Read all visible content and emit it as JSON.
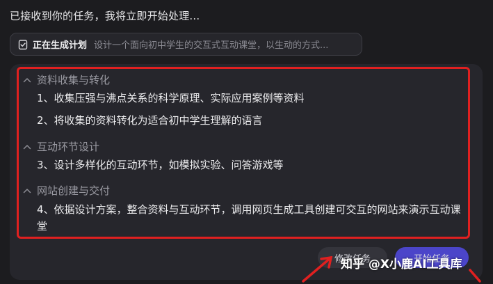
{
  "intro_text": "已接收到你的任务，我将立即开始处理...",
  "status": {
    "label": "正在生成计划",
    "description": "设计一个面向初中学生的交互式互动课堂，以生动的方式..."
  },
  "plan": {
    "sections": [
      {
        "title": "资料收集与转化",
        "items": [
          "1、收集压强与沸点关系的科学原理、实际应用案例等资料",
          "2、将收集的资料转化为适合初中学生理解的语言"
        ]
      },
      {
        "title": "互动环节设计",
        "items": [
          "3、设计多样化的互动环节，如模拟实验、问答游戏等"
        ]
      },
      {
        "title": "网站创建与交付",
        "items": [
          "4、依据设计方案，整合资料与互动环节，调用网页生成工具创建可交互的网站来演示互动课堂"
        ]
      }
    ]
  },
  "buttons": {
    "modify": "修改任务",
    "start": "开始任务"
  },
  "watermark": "知乎 @X小鹿AI工具库",
  "colors": {
    "highlight_box": "#e02020",
    "arrow": "#e02020",
    "start_button": "#4b45c9"
  },
  "icons": {
    "status": "check-clipboard-icon",
    "section_toggle": "chevron-up-icon"
  }
}
